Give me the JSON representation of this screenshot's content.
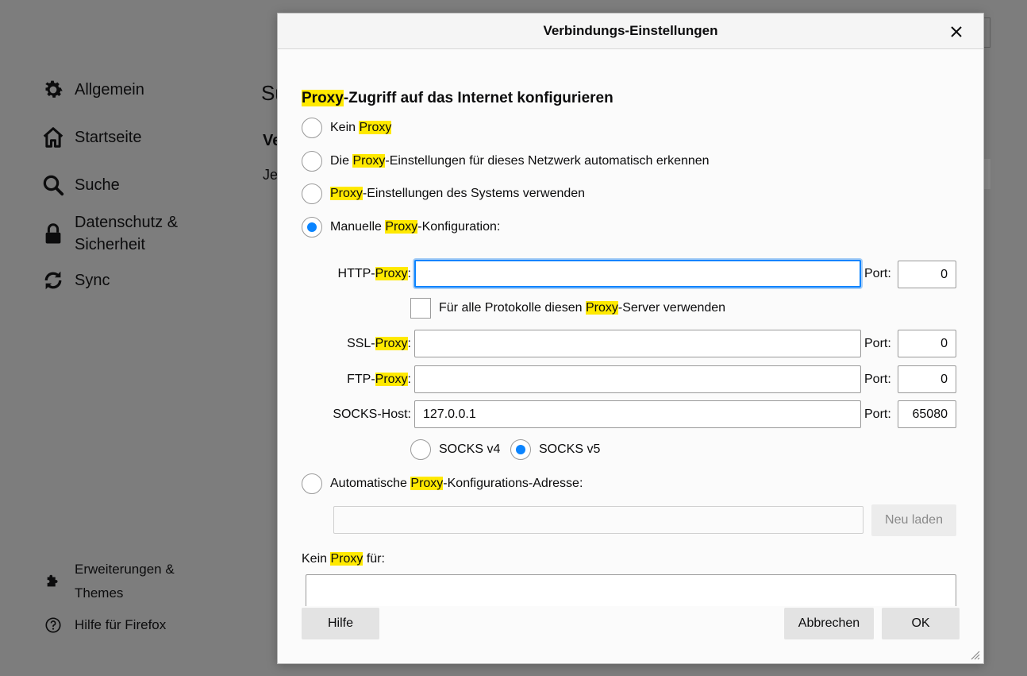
{
  "sidebar": {
    "items": [
      {
        "label": "Allgemein",
        "icon": "gear-icon"
      },
      {
        "label": "Startseite",
        "icon": "home-icon"
      },
      {
        "label": "Suche",
        "icon": "search-icon"
      },
      {
        "label": "Datenschutz & Sicherheit",
        "icon": "lock-icon"
      },
      {
        "label": "Sync",
        "icon": "sync-icon"
      }
    ],
    "footer": [
      {
        "label": "Erweiterungen & Themes",
        "icon": "puzzle-icon"
      },
      {
        "label": "Hilfe für Firefox",
        "icon": "help-icon"
      }
    ]
  },
  "background": {
    "peek_1": "Su",
    "peek_2": "Ve",
    "peek_3": "Je"
  },
  "dialog": {
    "title": "Verbindungs-Einstellungen",
    "heading": {
      "hl": "Proxy",
      "rest": "-Zugriff auf das Internet konfigurieren"
    },
    "options": [
      {
        "pre": "Kein ",
        "hl": "Proxy",
        "post": "",
        "checked": false
      },
      {
        "pre": "Die ",
        "hl": "Proxy",
        "post": "-Einstellungen für dieses Netzwerk automatisch erkennen",
        "checked": false
      },
      {
        "pre": "",
        "hl": "Proxy",
        "post": "-Einstellungen des Systems verwenden",
        "checked": false
      },
      {
        "pre": "Manuelle ",
        "hl": "Proxy",
        "post": "-Konfiguration:",
        "checked": true
      }
    ],
    "http": {
      "pre": "HTTP-",
      "hl": "Proxy",
      "post": ":",
      "value": "",
      "port_label": "Port:",
      "port": "0"
    },
    "all_protocols": {
      "pre": "Für alle Protokolle diesen ",
      "hl": "Proxy",
      "post": "-Server verwenden",
      "checked": false
    },
    "ssl": {
      "pre": "SSL-",
      "hl": "Proxy",
      "post": ":",
      "value": "",
      "port_label": "Port:",
      "port": "0"
    },
    "ftp": {
      "pre": "FTP-",
      "hl": "Proxy",
      "post": ":",
      "value": "",
      "port_label": "Port:",
      "port": "0"
    },
    "socks": {
      "label": "SOCKS-Host:",
      "value": "127.0.0.1",
      "port_label": "Port:",
      "port": "65080"
    },
    "socks_versions": [
      {
        "label": "SOCKS v4",
        "checked": false
      },
      {
        "label": "SOCKS v5",
        "checked": true
      }
    ],
    "auto_url": {
      "pre": "Automatische ",
      "hl": "Proxy",
      "post": "-Konfigurations-Adresse:",
      "checked": false,
      "value": "",
      "reload_label": "Neu laden"
    },
    "no_proxy": {
      "pre": "Kein ",
      "hl": "Proxy",
      "post": " für:",
      "value": ""
    },
    "buttons": {
      "help": "Hilfe",
      "cancel": "Abbrechen",
      "ok": "OK"
    }
  },
  "colors": {
    "accent": "#0a84ff",
    "highlight": "#ffe900",
    "overlay": "#7d7d7d"
  }
}
